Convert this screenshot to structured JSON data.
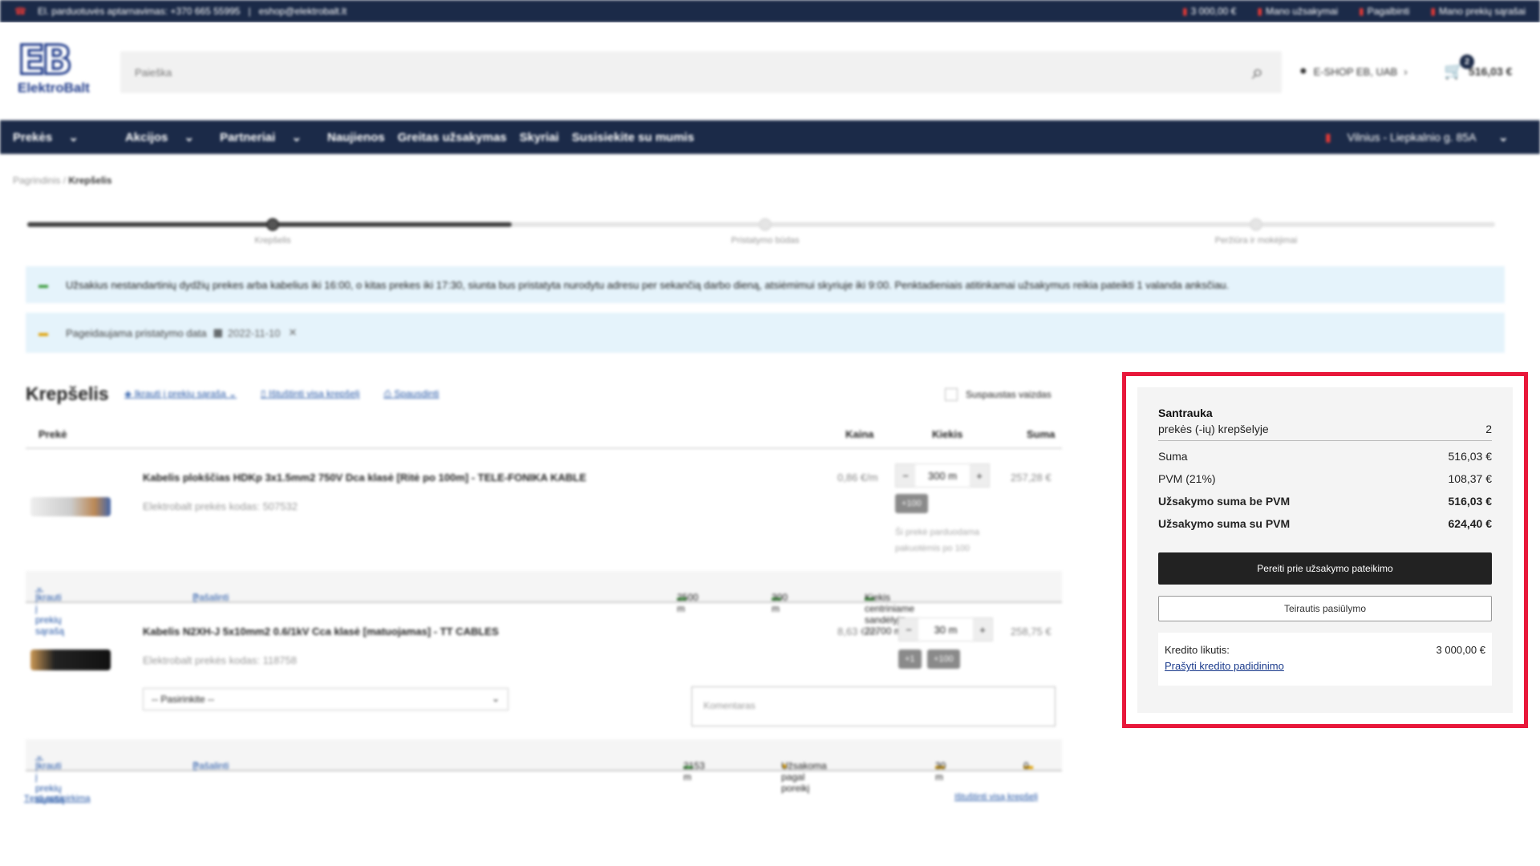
{
  "topbar": {
    "phone": "El. parduotuvės aptarnavimas: +370 665 55995",
    "separator": "|",
    "email": "eshop@elektrobalt.lt",
    "credit": "3 000,00 €",
    "orders": "Mano užsakymai",
    "help": "Pagalbinti",
    "lists": "Mano prekių sąrašai"
  },
  "header": {
    "logo_mark": "EB",
    "logo_name": "ElektroBalt",
    "search_placeholder": "Paieška",
    "user": "E-SHOP EB, UAB",
    "cart_count": "2",
    "cart_total": "516,03 €"
  },
  "nav": {
    "items": [
      "Prekės",
      "Akcijos",
      "Partneriai",
      "Naujienos",
      "Greitas užsakymas",
      "Skyriai",
      "Susisiekite su mumis"
    ],
    "branch": "Vilnius - Liepkalnio g. 85A"
  },
  "breadcrumb": {
    "home": "Pagrindinis",
    "sep": " / ",
    "current": "Krepšelis"
  },
  "steps": [
    "Krepšelis",
    "Pristatymo būdas",
    "Peržiūra ir mokėjimai"
  ],
  "progress": {
    "completed_fraction": 0.33
  },
  "info": {
    "notice": "Užsakius nestandartinių dydžių prekes arba kabelius iki 16:00, o kitas prekes iki 17:30, siunta bus pristatyta nurodytu adresu per sekančią darbo dieną, atsiėmimui skyriuje iki 9:00. Penktadieniais atitinkamai užsakymus reikia pateikti 1 valanda anksčiau.",
    "delivery_label": "Pageidaujama pristatymo data",
    "delivery_date": "2022-11-10",
    "clear": "✕"
  },
  "cart": {
    "title": "Krepšelis",
    "tools": [
      "Įkrauti į prekių sąrašą",
      "Ištuštinti visą krepšelį",
      "Spausdinti"
    ],
    "compact": "Suspaustas vaizdas",
    "columns": [
      "Prekė",
      "Kaina",
      "Kiekis",
      "Suma"
    ],
    "items": [
      {
        "name": "Kabelis plokščias HDKp 3x1.5mm2 750V Dca klasė [Ritė po 100m] - TELE-FONIKA KABLE",
        "code": "Elektrobalt prekės kodas: 507532",
        "price": "0,86 €/m",
        "qty": "300 m",
        "sum": "257,28 €",
        "chips": [
          "+100"
        ],
        "note_1": "Ši prekė parduodama",
        "note_2": "pakuotėmis po 100",
        "bar_list": "Įkrauti į prekių sąrašą",
        "bar_delete": "Pašalinti",
        "stock_1": "2500 m",
        "stock_2": "300 m",
        "stock_3": "Kiekis centriniame sandėlyje 22700 m"
      },
      {
        "name": "Kabelis N2XH-J 5x10mm2 0.6/1kV Cca klasė [matuojamas] - TT CABLES",
        "code": "Elektrobalt prekės kodas: 118758",
        "price": "8,63 €/m",
        "qty": "30 m",
        "sum": "258,75 €",
        "chips": [
          "+1",
          "+100"
        ],
        "select": "-- Pasirinkite --",
        "comment_placeholder": "Komentaras",
        "bar_list": "Įkrauti į prekių sąrašą",
        "bar_delete": "Pašalinti",
        "stock_1": "2153 m",
        "stock_2": "Užsakoma pagal poreikį",
        "stock_3": "30 m",
        "stock_4": "0"
      }
    ],
    "back": "Tęsti apsipirkimą",
    "clear_all": "Ištuštinti visą krepšelį"
  },
  "summary": {
    "title": "Santrauka",
    "items_label": "prekės (-ių) krepšelyje",
    "items_count": "2",
    "sum_label": "Suma",
    "sum_value": "516,03 €",
    "vat_label": "PVM (21%)",
    "vat_value": "108,37 €",
    "no_vat_label": "Užsakymo suma be PVM",
    "no_vat_value": "516,03 €",
    "with_vat_label": "Užsakymo suma su PVM",
    "with_vat_value": "624,40 €",
    "checkout_button": "Pereiti prie užsakymo pateikimo",
    "quote_button": "Teirautis pasiūlymo",
    "credit_label": "Kredito likutis:",
    "credit_value": "3 000,00 €",
    "credit_link": "Prašyti kredito padidinimo"
  },
  "colors": {
    "navy": "#1b2a48",
    "highlight": "#e8173a",
    "link": "#1b3b8c"
  }
}
